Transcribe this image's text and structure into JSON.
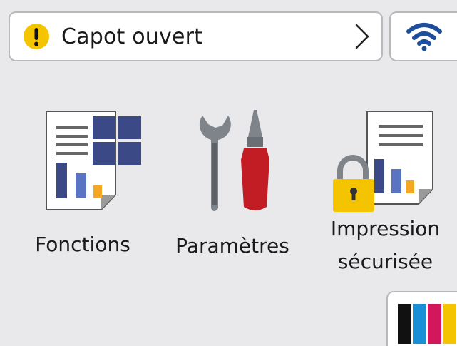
{
  "status": {
    "message": "Capot ouvert",
    "level": "warning",
    "warning_color": "#f5c400"
  },
  "network": {
    "icon": "wifi-icon",
    "color": "#1f4f9c"
  },
  "apps": [
    {
      "label": "Fonctions",
      "icon": "functions-icon"
    },
    {
      "label": "Paramètres",
      "icon": "settings-icon"
    },
    {
      "label": "Impression",
      "label2": "sécurisée",
      "icon": "secure-print-icon"
    }
  ],
  "ink": {
    "icon": "ink-cartridges-icon",
    "colors": [
      "#111111",
      "#1a8fd6",
      "#d2185a",
      "#f5c400"
    ]
  }
}
